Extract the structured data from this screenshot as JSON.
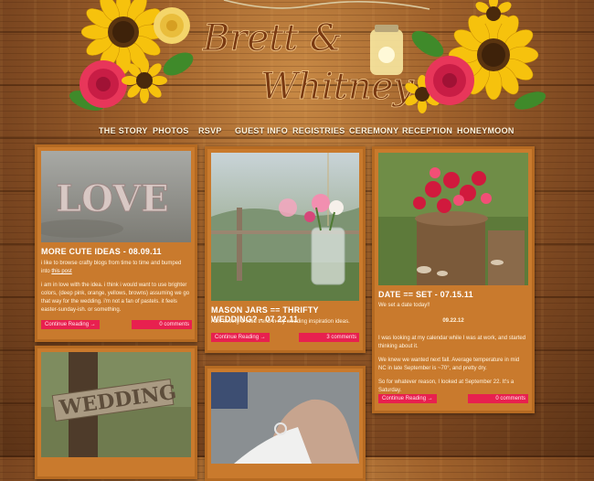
{
  "header": {
    "title_line1": "Brett &",
    "title_line2": "Whitney"
  },
  "nav": [
    {
      "label": "THE STORY"
    },
    {
      "label": "PHOTOS"
    },
    {
      "label": "RSVP"
    },
    {
      "label": "GUEST INFO"
    },
    {
      "label": "REGISTRIES"
    },
    {
      "label": "CEREMONY"
    },
    {
      "label": "RECEPTION"
    },
    {
      "label": "HONEYMOON"
    }
  ],
  "posts": [
    {
      "title": "MORE CUTE IDEAS - 08.09.11",
      "photo_text": "LOVE",
      "p1_before": "i like to browse crafty blogs from time to time and bumped into ",
      "p1_link": "this post",
      "p2": "i am in love with the idea. i think i would want to use brighter colors, (deep pink, orange, yellows, browns) assuming we go that way for the wedding. i'm not a fan of pastels. it feels easter-sunday-ish. or something.",
      "continue": "Continue Reading →",
      "comments": "0 comments"
    },
    {
      "title": "MASON JARS == THRIFTY WEDDING? - 07.22.11",
      "p1": "i am seeing a solid trend in my wedding inspiration ideas.",
      "continue": "Continue Reading →",
      "comments": "3 comments"
    },
    {
      "title": "DATE == SET - 07.15.11",
      "p1": "We set a date today!!",
      "date": "09.22.12",
      "p2": "I was looking at my calendar while I was at work, and started thinking about it.",
      "p3": "We knew we wanted next fall. Average temperature in mid NC in late September is ~70°, and pretty dry.",
      "p4": "So for whatever reason, I looked at September 22. It's a Saturday.",
      "continue": "Continue Reading →",
      "comments": "0 comments"
    },
    {
      "photo_text": "WEDDING"
    }
  ],
  "colors": {
    "card": "#c97a2d",
    "button": "#e8204f",
    "text": "#fff4e0"
  }
}
